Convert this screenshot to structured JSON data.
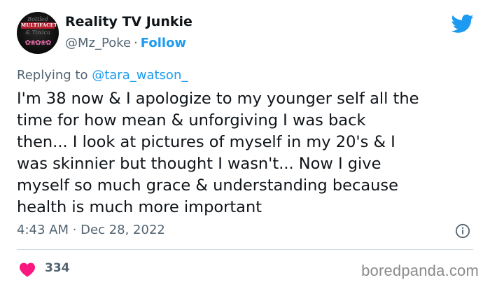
{
  "author": {
    "display_name": "Reality TV Junkie",
    "handle": "@Mz_Poke",
    "separator": "·",
    "follow_label": "Follow",
    "avatar": {
      "line1": "Bottled",
      "line2": "MULTIFACETED",
      "line3": "& Toxica",
      "flowers": "✿❀✿❀✿"
    }
  },
  "reply": {
    "prefix": "Replying to",
    "mention": "@tara_watson_"
  },
  "tweet": {
    "lines": [
      "I'm 38 now & I apologize to my younger self all the",
      "time for how mean & unforgiving I was back",
      "then... I look at pictures of myself in my 20's & I",
      "was skinnier but thought I wasn't... Now I give",
      "myself so much grace & understanding because",
      "health is much more important"
    ],
    "timestamp": "4:43 AM · Dec 28, 2022",
    "likes": "334"
  },
  "watermark": "boredpanda.com",
  "icons": {
    "brand": "twitter-bird-icon",
    "info": "info-icon",
    "like": "heart-icon"
  },
  "colors": {
    "accent": "#1d9bf0",
    "heart": "#f91880",
    "secondary_text": "#536471",
    "divider": "#cfd9de"
  }
}
